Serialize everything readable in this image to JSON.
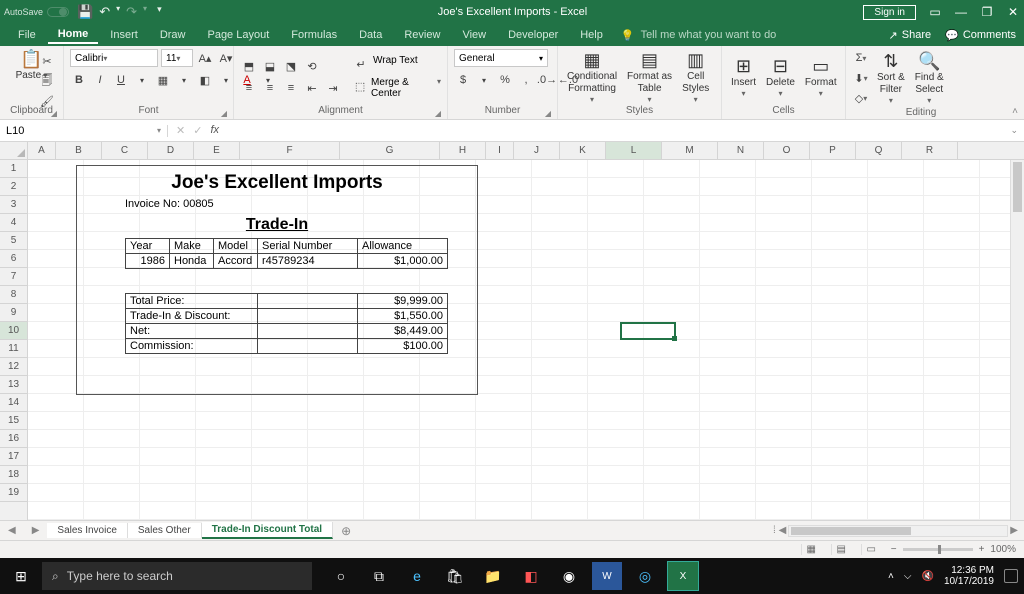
{
  "titlebar": {
    "autosave": "AutoSave",
    "title": "Joe's Excellent Imports  -  Excel",
    "signin": "Sign in"
  },
  "tabs": {
    "items": [
      "File",
      "Home",
      "Insert",
      "Draw",
      "Page Layout",
      "Formulas",
      "Data",
      "Review",
      "View",
      "Developer",
      "Help"
    ],
    "active": 1,
    "tell": "Tell me what you want to do",
    "share": "Share",
    "comments": "Comments"
  },
  "ribbon": {
    "clipboard": {
      "paste": "Paste",
      "label": "Clipboard"
    },
    "font": {
      "name": "Calibri",
      "size": "11",
      "label": "Font"
    },
    "alignment": {
      "wrap": "Wrap Text",
      "merge": "Merge & Center",
      "label": "Alignment"
    },
    "number": {
      "format": "General",
      "label": "Number"
    },
    "styles": {
      "cond": "Conditional",
      "cond2": "Formatting",
      "fat": "Format as",
      "fat2": "Table",
      "cell": "Cell",
      "cell2": "Styles",
      "label": "Styles"
    },
    "cells": {
      "insert": "Insert",
      "delete": "Delete",
      "format": "Format",
      "label": "Cells"
    },
    "editing": {
      "sort": "Sort &",
      "sort2": "Filter",
      "find": "Find &",
      "find2": "Select",
      "label": "Editing"
    }
  },
  "namebox": "L10",
  "cols": [
    "A",
    "B",
    "C",
    "D",
    "E",
    "F",
    "G",
    "H",
    "I",
    "J",
    "K",
    "L",
    "M",
    "N",
    "O",
    "P",
    "Q",
    "R"
  ],
  "rows": [
    "1",
    "2",
    "3",
    "4",
    "5",
    "6",
    "7",
    "8",
    "9",
    "10",
    "11",
    "12",
    "13",
    "14",
    "15",
    "16",
    "17",
    "18",
    "19"
  ],
  "doc": {
    "title": "Joe's Excellent Imports",
    "invno": "Invoice No: 00805",
    "section": "Trade-In",
    "hdr": [
      "Year",
      "Make",
      "Model",
      "Serial Number",
      "Allowance"
    ],
    "row": [
      "1986",
      "Honda",
      "Accord",
      "r45789234",
      "$1,000.00"
    ],
    "totals": [
      [
        "Total Price:",
        "",
        "$9,999.00"
      ],
      [
        "Trade-In & Discount:",
        "",
        "$1,550.00"
      ],
      [
        "Net:",
        "",
        "$8,449.00"
      ],
      [
        "Commission:",
        "",
        "$100.00"
      ]
    ]
  },
  "sheets": {
    "items": [
      "Sales Invoice",
      "Sales Other",
      "Trade-In Discount Total"
    ],
    "active": 2
  },
  "status": {
    "zoom": "100%"
  },
  "taskbar": {
    "search": "Type here to search",
    "time": "12:36 PM",
    "date": "10/17/2019"
  }
}
